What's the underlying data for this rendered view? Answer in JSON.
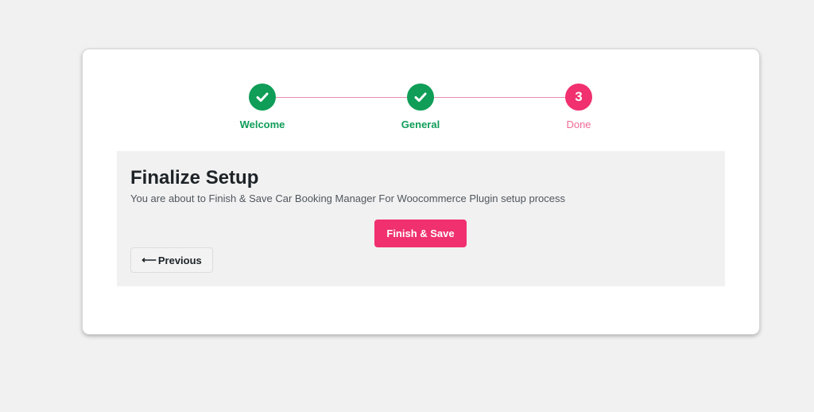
{
  "stepper": {
    "steps": [
      {
        "label": "Welcome",
        "state": "done",
        "icon": "check-icon"
      },
      {
        "label": "General",
        "state": "done",
        "icon": "check-icon"
      },
      {
        "label": "Done",
        "state": "current",
        "number": "3"
      }
    ],
    "colors": {
      "done": "#0f9d58",
      "current": "#f0306f",
      "line": "#e78fb3"
    }
  },
  "panel": {
    "title": "Finalize Setup",
    "description": "You are about to Finish & Save Car Booking Manager For Woocommerce Plugin setup process",
    "finish_label": "Finish & Save",
    "previous_arrow": "⟵",
    "previous_label": "Previous"
  }
}
